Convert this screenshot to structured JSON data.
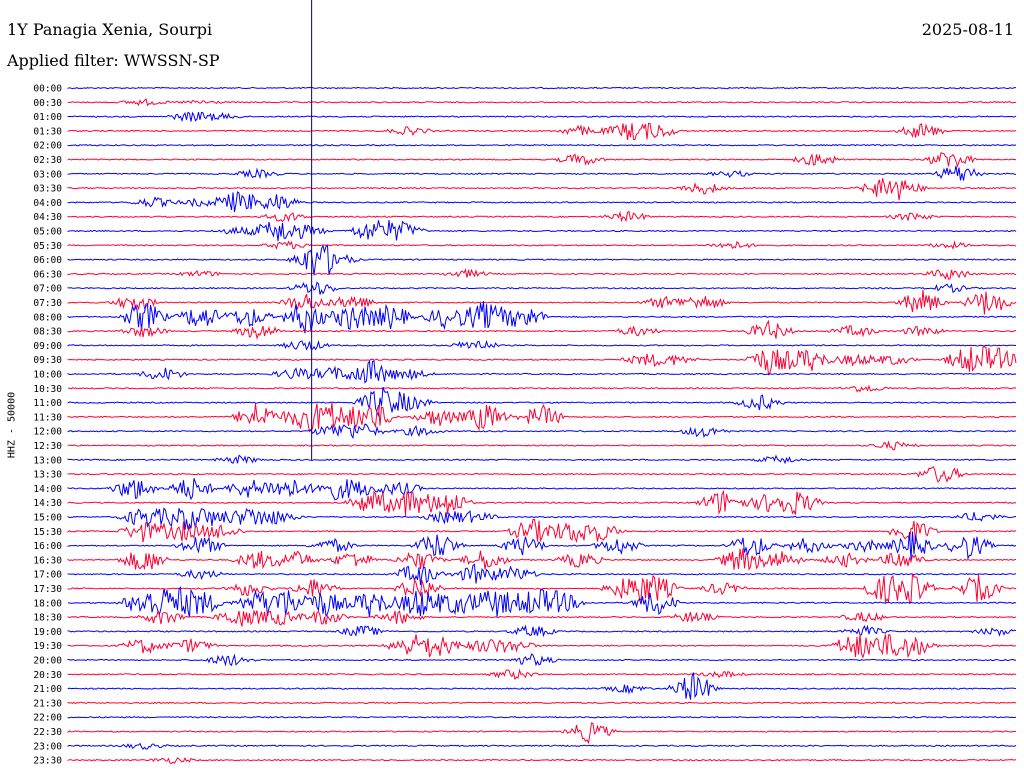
{
  "header": {
    "station": "1Y Panagia Xenia, Sourpi",
    "filter": "Applied filter: WWSSN-SP",
    "date": "2025-08-11"
  },
  "y_axis_label": "HHZ - 50000",
  "colors": {
    "blue": "#0000ff",
    "red": "#ff0033",
    "marker": "#00008b"
  },
  "rows": [
    {
      "label": "00:00",
      "color": "blue",
      "activity": []
    },
    {
      "label": "00:30",
      "color": "red",
      "activity": [
        [
          0.08,
          0.3
        ],
        [
          0.14,
          0.2
        ]
      ]
    },
    {
      "label": "01:00",
      "color": "blue",
      "activity": [
        [
          0.13,
          0.5
        ],
        [
          0.16,
          0.3
        ]
      ]
    },
    {
      "label": "01:30",
      "color": "red",
      "activity": [
        [
          0.36,
          0.4
        ],
        [
          0.54,
          0.5
        ],
        [
          0.59,
          0.9
        ],
        [
          0.62,
          0.8
        ],
        [
          0.9,
          0.8
        ]
      ]
    },
    {
      "label": "02:00",
      "color": "blue",
      "activity": []
    },
    {
      "label": "02:30",
      "color": "red",
      "activity": [
        [
          0.54,
          0.6
        ],
        [
          0.79,
          0.7
        ],
        [
          0.93,
          1.0
        ]
      ]
    },
    {
      "label": "03:00",
      "color": "blue",
      "activity": [
        [
          0.2,
          0.4
        ],
        [
          0.7,
          0.3
        ],
        [
          0.94,
          1.0
        ]
      ]
    },
    {
      "label": "03:30",
      "color": "red",
      "activity": [
        [
          0.67,
          0.6
        ],
        [
          0.86,
          1.0
        ],
        [
          0.88,
          0.8
        ]
      ]
    },
    {
      "label": "04:00",
      "color": "blue",
      "activity": [
        [
          0.09,
          0.5
        ],
        [
          0.14,
          0.4
        ],
        [
          0.18,
          1.2
        ],
        [
          0.22,
          0.9
        ]
      ]
    },
    {
      "label": "04:30",
      "color": "red",
      "activity": [
        [
          0.23,
          0.5
        ],
        [
          0.59,
          0.5
        ],
        [
          0.89,
          0.4
        ]
      ]
    },
    {
      "label": "05:00",
      "color": "blue",
      "activity": [
        [
          0.18,
          0.4
        ],
        [
          0.22,
          1.2
        ],
        [
          0.25,
          0.6
        ],
        [
          0.32,
          1.1
        ],
        [
          0.35,
          1.0
        ]
      ]
    },
    {
      "label": "05:30",
      "color": "red",
      "activity": [
        [
          0.23,
          0.4
        ],
        [
          0.7,
          0.4
        ],
        [
          0.93,
          0.3
        ]
      ]
    },
    {
      "label": "06:00",
      "color": "blue",
      "activity": [
        [
          0.26,
          1.6
        ],
        [
          0.28,
          0.8
        ]
      ]
    },
    {
      "label": "06:30",
      "color": "red",
      "activity": [
        [
          0.14,
          0.3
        ],
        [
          0.42,
          0.4
        ],
        [
          0.93,
          0.6
        ]
      ]
    },
    {
      "label": "07:00",
      "color": "blue",
      "activity": [
        [
          0.26,
          0.8
        ],
        [
          0.93,
          0.4
        ]
      ]
    },
    {
      "label": "07:30",
      "color": "red",
      "activity": [
        [
          0.07,
          0.8
        ],
        [
          0.25,
          1.0
        ],
        [
          0.3,
          0.8
        ],
        [
          0.63,
          0.6
        ],
        [
          0.67,
          0.8
        ],
        [
          0.9,
          1.3
        ],
        [
          0.97,
          1.4
        ]
      ]
    },
    {
      "label": "08:00",
      "color": "blue",
      "activity": [
        [
          0.08,
          1.6
        ],
        [
          0.14,
          1.3
        ],
        [
          0.19,
          1.1
        ],
        [
          0.25,
          1.8
        ],
        [
          0.3,
          1.5
        ],
        [
          0.34,
          1.3
        ],
        [
          0.4,
          1.2
        ],
        [
          0.44,
          1.6
        ],
        [
          0.48,
          1.3
        ]
      ]
    },
    {
      "label": "08:30",
      "color": "red",
      "activity": [
        [
          0.08,
          0.6
        ],
        [
          0.2,
          0.8
        ],
        [
          0.6,
          0.5
        ],
        [
          0.74,
          1.0
        ],
        [
          0.83,
          0.6
        ],
        [
          0.9,
          0.5
        ]
      ]
    },
    {
      "label": "09:00",
      "color": "blue",
      "activity": [
        [
          0.25,
          0.6
        ],
        [
          0.43,
          0.6
        ]
      ]
    },
    {
      "label": "09:30",
      "color": "red",
      "activity": [
        [
          0.61,
          0.6
        ],
        [
          0.64,
          0.5
        ],
        [
          0.74,
          1.5
        ],
        [
          0.78,
          1.3
        ],
        [
          0.83,
          0.6
        ],
        [
          0.87,
          0.5
        ],
        [
          0.95,
          1.4
        ],
        [
          0.98,
          1.2
        ]
      ]
    },
    {
      "label": "10:00",
      "color": "blue",
      "activity": [
        [
          0.1,
          0.7
        ],
        [
          0.24,
          0.6
        ],
        [
          0.28,
          0.7
        ],
        [
          0.32,
          1.4
        ],
        [
          0.36,
          0.5
        ]
      ]
    },
    {
      "label": "10:30",
      "color": "red",
      "activity": [
        [
          0.84,
          0.4
        ]
      ]
    },
    {
      "label": "11:00",
      "color": "blue",
      "activity": [
        [
          0.33,
          1.6
        ],
        [
          0.36,
          0.8
        ],
        [
          0.73,
          0.8
        ]
      ]
    },
    {
      "label": "11:30",
      "color": "red",
      "activity": [
        [
          0.2,
          1.5
        ],
        [
          0.25,
          1.4
        ],
        [
          0.28,
          1.5
        ],
        [
          0.32,
          1.6
        ],
        [
          0.39,
          1.0
        ],
        [
          0.44,
          1.5
        ],
        [
          0.5,
          1.2
        ]
      ]
    },
    {
      "label": "12:00",
      "color": "blue",
      "activity": [
        [
          0.28,
          0.7
        ],
        [
          0.31,
          0.8
        ],
        [
          0.37,
          0.5
        ],
        [
          0.67,
          0.6
        ]
      ]
    },
    {
      "label": "12:30",
      "color": "red",
      "activity": [
        [
          0.87,
          0.4
        ]
      ]
    },
    {
      "label": "13:00",
      "color": "blue",
      "activity": [
        [
          0.18,
          0.4
        ],
        [
          0.75,
          0.4
        ]
      ]
    },
    {
      "label": "13:30",
      "color": "red",
      "activity": [
        [
          0.92,
          1.0
        ]
      ]
    },
    {
      "label": "14:00",
      "color": "blue",
      "activity": [
        [
          0.07,
          1.2
        ],
        [
          0.13,
          1.2
        ],
        [
          0.19,
          1.0
        ],
        [
          0.23,
          1.2
        ],
        [
          0.28,
          1.1
        ],
        [
          0.31,
          0.8
        ],
        [
          0.35,
          0.7
        ]
      ]
    },
    {
      "label": "14:30",
      "color": "red",
      "activity": [
        [
          0.32,
          1.3
        ],
        [
          0.36,
          1.5
        ],
        [
          0.4,
          1.4
        ],
        [
          0.69,
          1.3
        ],
        [
          0.74,
          1.0
        ],
        [
          0.77,
          1.2
        ]
      ]
    },
    {
      "label": "15:00",
      "color": "blue",
      "activity": [
        [
          0.08,
          1.1
        ],
        [
          0.12,
          1.3
        ],
        [
          0.15,
          0.9
        ],
        [
          0.19,
          1.0
        ],
        [
          0.22,
          0.7
        ],
        [
          0.4,
          0.6
        ],
        [
          0.43,
          0.5
        ],
        [
          0.96,
          0.5
        ]
      ]
    },
    {
      "label": "15:30",
      "color": "red",
      "activity": [
        [
          0.08,
          1.1
        ],
        [
          0.12,
          1.0
        ],
        [
          0.16,
          0.8
        ],
        [
          0.49,
          1.3
        ],
        [
          0.53,
          1.1
        ],
        [
          0.56,
          1.0
        ],
        [
          0.89,
          1.4
        ]
      ]
    },
    {
      "label": "16:00",
      "color": "blue",
      "activity": [
        [
          0.14,
          1.0
        ],
        [
          0.28,
          0.7
        ],
        [
          0.39,
          1.4
        ],
        [
          0.48,
          1.0
        ],
        [
          0.58,
          0.9
        ],
        [
          0.72,
          1.3
        ],
        [
          0.78,
          0.8
        ],
        [
          0.84,
          0.6
        ],
        [
          0.89,
          1.4
        ],
        [
          0.95,
          1.3
        ]
      ]
    },
    {
      "label": "16:30",
      "color": "red",
      "activity": [
        [
          0.08,
          1.3
        ],
        [
          0.2,
          1.0
        ],
        [
          0.24,
          0.9
        ],
        [
          0.3,
          0.9
        ],
        [
          0.37,
          1.0
        ],
        [
          0.44,
          1.1
        ],
        [
          0.54,
          0.8
        ],
        [
          0.71,
          1.3
        ],
        [
          0.75,
          1.0
        ],
        [
          0.82,
          0.7
        ],
        [
          0.88,
          1.0
        ]
      ]
    },
    {
      "label": "17:00",
      "color": "blue",
      "activity": [
        [
          0.14,
          0.5
        ],
        [
          0.37,
          1.2
        ],
        [
          0.43,
          1.0
        ],
        [
          0.47,
          0.8
        ]
      ]
    },
    {
      "label": "17:30",
      "color": "red",
      "activity": [
        [
          0.19,
          0.8
        ],
        [
          0.26,
          1.0
        ],
        [
          0.37,
          1.2
        ],
        [
          0.59,
          1.2
        ],
        [
          0.62,
          1.4
        ],
        [
          0.69,
          0.6
        ],
        [
          0.86,
          1.3
        ],
        [
          0.89,
          1.5
        ],
        [
          0.96,
          1.4
        ]
      ]
    },
    {
      "label": "18:00",
      "color": "blue",
      "activity": [
        [
          0.08,
          1.4
        ],
        [
          0.11,
          1.6
        ],
        [
          0.14,
          1.3
        ],
        [
          0.2,
          1.2
        ],
        [
          0.23,
          1.5
        ],
        [
          0.27,
          1.4
        ],
        [
          0.32,
          1.5
        ],
        [
          0.37,
          1.6
        ],
        [
          0.41,
          1.3
        ],
        [
          0.45,
          1.6
        ],
        [
          0.49,
          1.4
        ],
        [
          0.52,
          1.1
        ],
        [
          0.62,
          1.3
        ]
      ]
    },
    {
      "label": "18:30",
      "color": "red",
      "activity": [
        [
          0.1,
          0.8
        ],
        [
          0.18,
          1.0
        ],
        [
          0.22,
          0.9
        ],
        [
          0.27,
          0.8
        ],
        [
          0.35,
          0.7
        ],
        [
          0.66,
          0.6
        ],
        [
          0.84,
          0.5
        ]
      ]
    },
    {
      "label": "19:00",
      "color": "blue",
      "activity": [
        [
          0.31,
          0.6
        ],
        [
          0.49,
          0.6
        ],
        [
          0.84,
          0.5
        ],
        [
          0.98,
          0.4
        ]
      ]
    },
    {
      "label": "19:30",
      "color": "red",
      "activity": [
        [
          0.08,
          0.8
        ],
        [
          0.13,
          0.7
        ],
        [
          0.36,
          1.1
        ],
        [
          0.39,
          1.2
        ],
        [
          0.44,
          0.7
        ],
        [
          0.47,
          0.6
        ],
        [
          0.83,
          1.3
        ],
        [
          0.86,
          1.1
        ],
        [
          0.89,
          1.2
        ]
      ]
    },
    {
      "label": "20:00",
      "color": "blue",
      "activity": [
        [
          0.17,
          0.6
        ],
        [
          0.49,
          0.6
        ]
      ]
    },
    {
      "label": "20:30",
      "color": "red",
      "activity": [
        [
          0.47,
          0.5
        ],
        [
          0.69,
          0.3
        ]
      ]
    },
    {
      "label": "21:00",
      "color": "blue",
      "activity": [
        [
          0.59,
          0.4
        ],
        [
          0.66,
          1.6
        ]
      ]
    },
    {
      "label": "21:30",
      "color": "red",
      "activity": []
    },
    {
      "label": "22:00",
      "color": "blue",
      "activity": []
    },
    {
      "label": "22:30",
      "color": "red",
      "activity": [
        [
          0.55,
          1.1
        ]
      ]
    },
    {
      "label": "23:00",
      "color": "blue",
      "activity": [
        [
          0.08,
          0.3
        ]
      ]
    },
    {
      "label": "23:30",
      "color": "red",
      "activity": [
        [
          0.11,
          0.3
        ]
      ]
    }
  ],
  "marker_fraction": 0.257
}
